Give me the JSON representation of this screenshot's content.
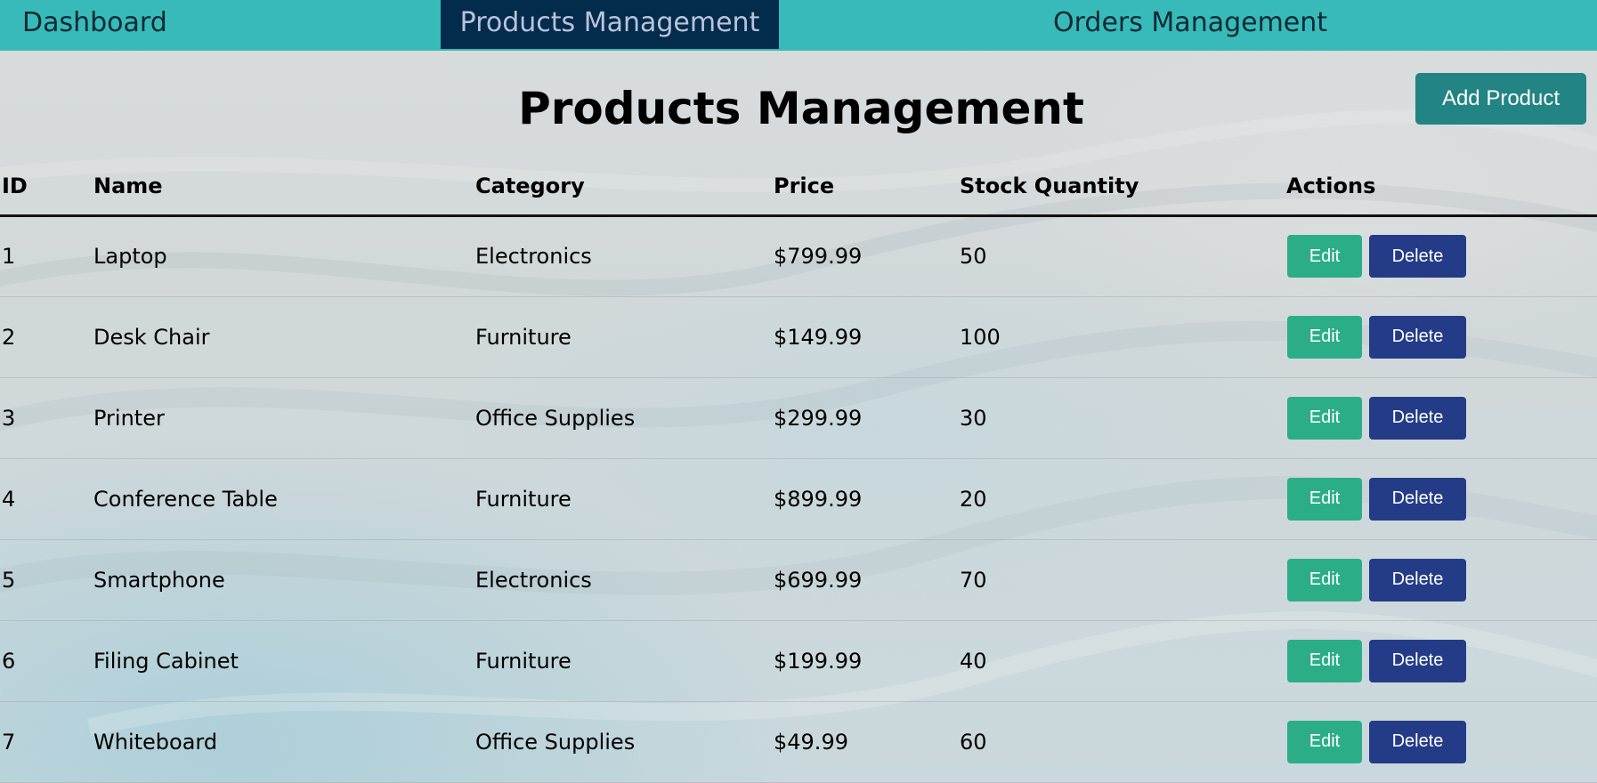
{
  "nav": {
    "items": [
      {
        "label": "Dashboard"
      },
      {
        "label": "Products Management"
      },
      {
        "label": "Orders Management"
      }
    ],
    "active": "Products Management"
  },
  "header": {
    "title": "Products Management",
    "add_button_label": "Add Product"
  },
  "table": {
    "columns": [
      "ID",
      "Name",
      "Category",
      "Price",
      "Stock Quantity",
      "Actions"
    ],
    "rows": [
      {
        "id": "1",
        "name": "Laptop",
        "category": "Electronics",
        "price": "$799.99",
        "stock": "50"
      },
      {
        "id": "2",
        "name": "Desk Chair",
        "category": "Furniture",
        "price": "$149.99",
        "stock": "100"
      },
      {
        "id": "3",
        "name": "Printer",
        "category": "Office Supplies",
        "price": "$299.99",
        "stock": "30"
      },
      {
        "id": "4",
        "name": "Conference Table",
        "category": "Furniture",
        "price": "$899.99",
        "stock": "20"
      },
      {
        "id": "5",
        "name": "Smartphone",
        "category": "Electronics",
        "price": "$699.99",
        "stock": "70"
      },
      {
        "id": "6",
        "name": "Filing Cabinet",
        "category": "Furniture",
        "price": "$199.99",
        "stock": "40"
      },
      {
        "id": "7",
        "name": "Whiteboard",
        "category": "Office Supplies",
        "price": "$49.99",
        "stock": "60"
      }
    ],
    "actions": {
      "edit_label": "Edit",
      "delete_label": "Delete"
    }
  },
  "colors": {
    "nav_bg": "#38baba",
    "nav_active_bg": "#032b4b",
    "add_button": "#238484",
    "edit_button": "#2bae88",
    "delete_button": "#243b88"
  }
}
